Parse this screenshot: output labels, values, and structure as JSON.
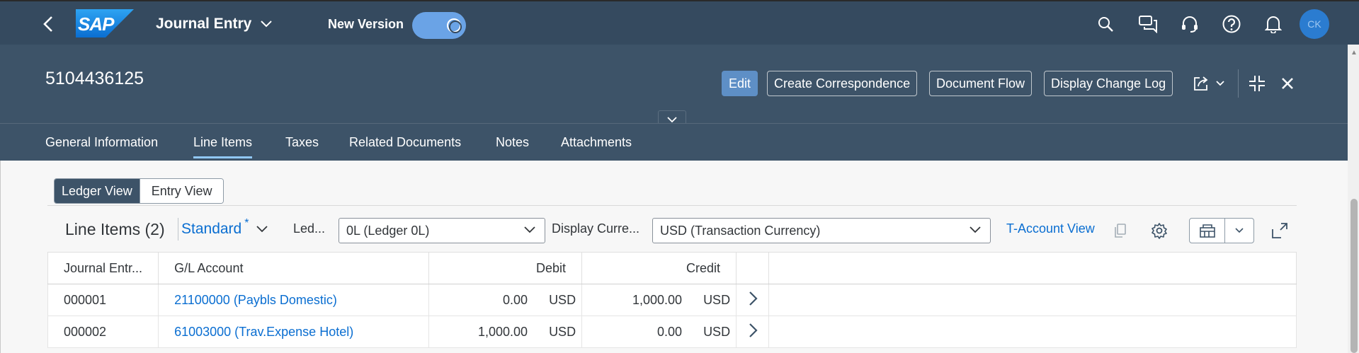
{
  "shell": {
    "logo_text": "SAP",
    "app_title": "Journal Entry",
    "new_version_label": "New Version",
    "toggle_on": true,
    "avatar_initials": "CK",
    "icons": [
      "search-icon",
      "chat-icon",
      "headset-icon",
      "help-icon",
      "notification-icon"
    ]
  },
  "header": {
    "document_number": "5104436125",
    "buttons": {
      "edit": "Edit",
      "create_correspondence": "Create Correspondence",
      "document_flow": "Document Flow",
      "display_change_log": "Display Change Log"
    }
  },
  "tabs": [
    {
      "label": "General Information",
      "active": false
    },
    {
      "label": "Line Items",
      "active": true
    },
    {
      "label": "Taxes",
      "active": false
    },
    {
      "label": "Related Documents",
      "active": false
    },
    {
      "label": "Notes",
      "active": false
    },
    {
      "label": "Attachments",
      "active": false
    }
  ],
  "view_toggle": {
    "ledger_view": "Ledger View",
    "entry_view": "Entry View"
  },
  "toolbar": {
    "title": "Line Items (2)",
    "variant": "Standard",
    "variant_modified_mark": "*",
    "ledger_label": "Led...",
    "ledger_value": "0L (Ledger 0L)",
    "currency_label": "Display Curre...",
    "currency_value": "USD (Transaction Currency)",
    "t_account_view": "T-Account View"
  },
  "table": {
    "columns": [
      "Journal Entr...",
      "G/L Account",
      "Debit",
      "Credit"
    ],
    "rows": [
      {
        "entry": "000001",
        "account": "21100000 (Paybls Domestic)",
        "debit": "0.00",
        "debit_cur": "USD",
        "credit": "1,000.00",
        "credit_cur": "USD"
      },
      {
        "entry": "000002",
        "account": "61003000 (Trav.Expense Hotel)",
        "debit": "1,000.00",
        "debit_cur": "USD",
        "credit": "0.00",
        "credit_cur": "USD"
      }
    ]
  },
  "colors": {
    "shell_bg": "#354a5f",
    "header_bg": "#3d5368",
    "accent": "#0a6ed1",
    "toggle_on": "#6aa3e6",
    "avatar": "#2b7cd0"
  }
}
